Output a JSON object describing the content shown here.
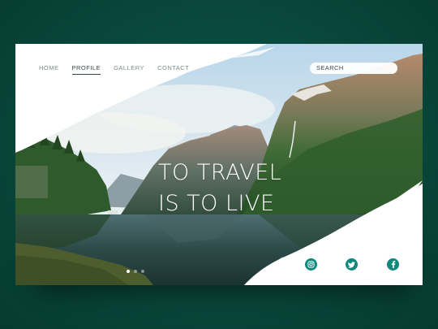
{
  "nav": {
    "items": [
      {
        "label": "HOME",
        "active": false
      },
      {
        "label": "PROFILE",
        "active": true
      },
      {
        "label": "GALLERY",
        "active": false
      },
      {
        "label": "CONTACT",
        "active": false
      }
    ]
  },
  "search": {
    "label": "SEARCH"
  },
  "hero": {
    "line1": "TO TRAVEL",
    "line2": "IS TO LIVE"
  },
  "slider": {
    "count": 3,
    "active_index": 0
  },
  "social": [
    {
      "icon": "instagram-icon"
    },
    {
      "icon": "twitter-icon"
    },
    {
      "icon": "facebook-icon"
    }
  ],
  "colors": {
    "accent": "#0e8a7c",
    "background": "#0a4a3e"
  }
}
